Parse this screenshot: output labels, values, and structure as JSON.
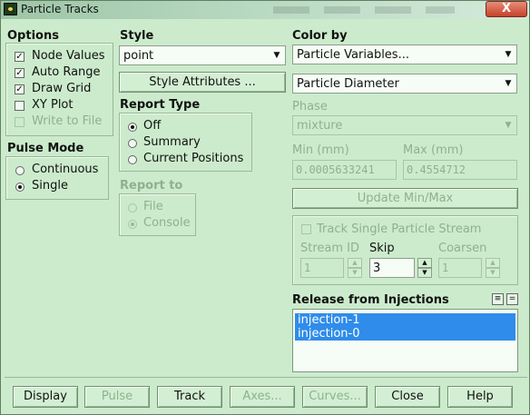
{
  "window": {
    "title": "Particle Tracks",
    "close_glyph": "X"
  },
  "options": {
    "heading": "Options",
    "items": [
      {
        "label": "Node Values",
        "checked": true,
        "enabled": true
      },
      {
        "label": "Auto Range",
        "checked": true,
        "enabled": true
      },
      {
        "label": "Draw Grid",
        "checked": true,
        "enabled": true
      },
      {
        "label": "XY Plot",
        "checked": false,
        "enabled": true
      },
      {
        "label": "Write to File",
        "checked": false,
        "enabled": false
      }
    ]
  },
  "pulse_mode": {
    "heading": "Pulse Mode",
    "options": [
      {
        "label": "Continuous",
        "selected": false
      },
      {
        "label": "Single",
        "selected": true
      }
    ]
  },
  "style": {
    "heading": "Style",
    "value": "point",
    "attributes_button": "Style Attributes ..."
  },
  "report_type": {
    "heading": "Report Type",
    "options": [
      {
        "label": "Off",
        "selected": true
      },
      {
        "label": "Summary",
        "selected": false
      },
      {
        "label": "Current Positions",
        "selected": false
      }
    ]
  },
  "report_to": {
    "heading": "Report to",
    "options": [
      {
        "label": "File",
        "selected": false
      },
      {
        "label": "Console",
        "selected": true
      }
    ]
  },
  "color_by": {
    "heading": "Color by",
    "category": "Particle Variables...",
    "variable": "Particle Diameter"
  },
  "phase": {
    "heading": "Phase",
    "value": "mixture"
  },
  "range": {
    "min_label": "Min (mm)",
    "min_value": "0.0005633241",
    "max_label": "Max (mm)",
    "max_value": "0.4554712",
    "update_button": "Update Min/Max"
  },
  "track_single": {
    "label": "Track Single Particle Stream",
    "checked": false,
    "stream_id_label": "Stream ID",
    "stream_id_value": "1",
    "skip_label": "Skip",
    "skip_value": "3",
    "coarsen_label": "Coarsen",
    "coarsen_value": "1"
  },
  "release": {
    "heading": "Release from Injections",
    "items": [
      "injection-1",
      "injection-0"
    ],
    "select_all_glyph": "≡",
    "deselect_glyph": "="
  },
  "buttons": {
    "display": "Display",
    "pulse": "Pulse",
    "track": "Track",
    "axes": "Axes...",
    "curves": "Curves...",
    "close": "Close",
    "help": "Help"
  },
  "colors": {
    "background": "#ccebcc",
    "selection": "#2f8cea",
    "disabled_text": "#8fb08f"
  }
}
